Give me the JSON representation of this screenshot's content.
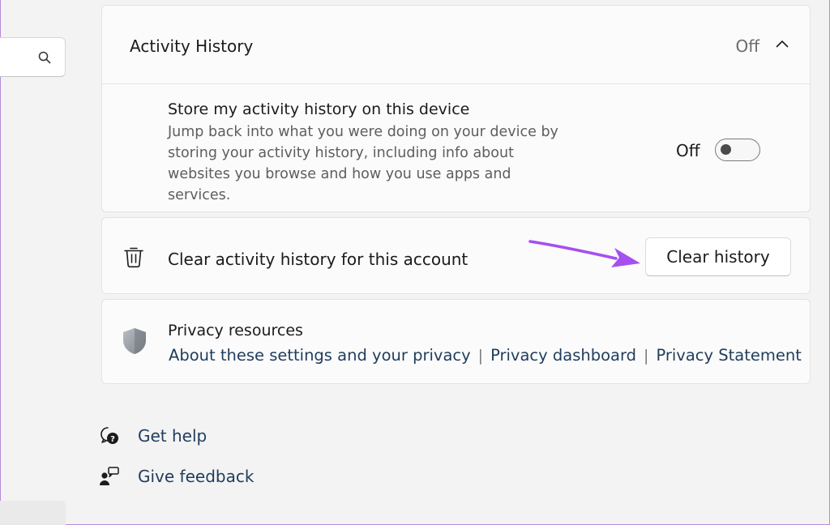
{
  "sidebar": {
    "search": {
      "icon": "search-icon"
    }
  },
  "activity_history": {
    "title": "Activity History",
    "state": "Off",
    "chevron_icon": "chevron-up-icon",
    "store": {
      "title": "Store my activity history on this device",
      "description": "Jump back into what you were doing on your device by storing your activity history, including info about websites you browse and how you use apps and services.",
      "toggle_label": "Off",
      "toggle_on": false
    }
  },
  "clear_history": {
    "icon": "trash-icon",
    "label": "Clear activity history for this account",
    "button_label": "Clear history",
    "annotation_arrow_color": "#a64ff0"
  },
  "privacy": {
    "icon": "shield-icon",
    "title": "Privacy resources",
    "links": [
      "About these settings and your privacy",
      "Privacy dashboard",
      "Privacy Statement"
    ],
    "separator": "|"
  },
  "footer": {
    "get_help": {
      "icon": "help-icon",
      "label": "Get help"
    },
    "give_feedback": {
      "icon": "feedback-icon",
      "label": "Give feedback"
    }
  },
  "colors": {
    "background": "#f3f3f3",
    "card": "#fbfbfb",
    "link": "#1f3d5c",
    "accent_arrow": "#a64ff0"
  }
}
